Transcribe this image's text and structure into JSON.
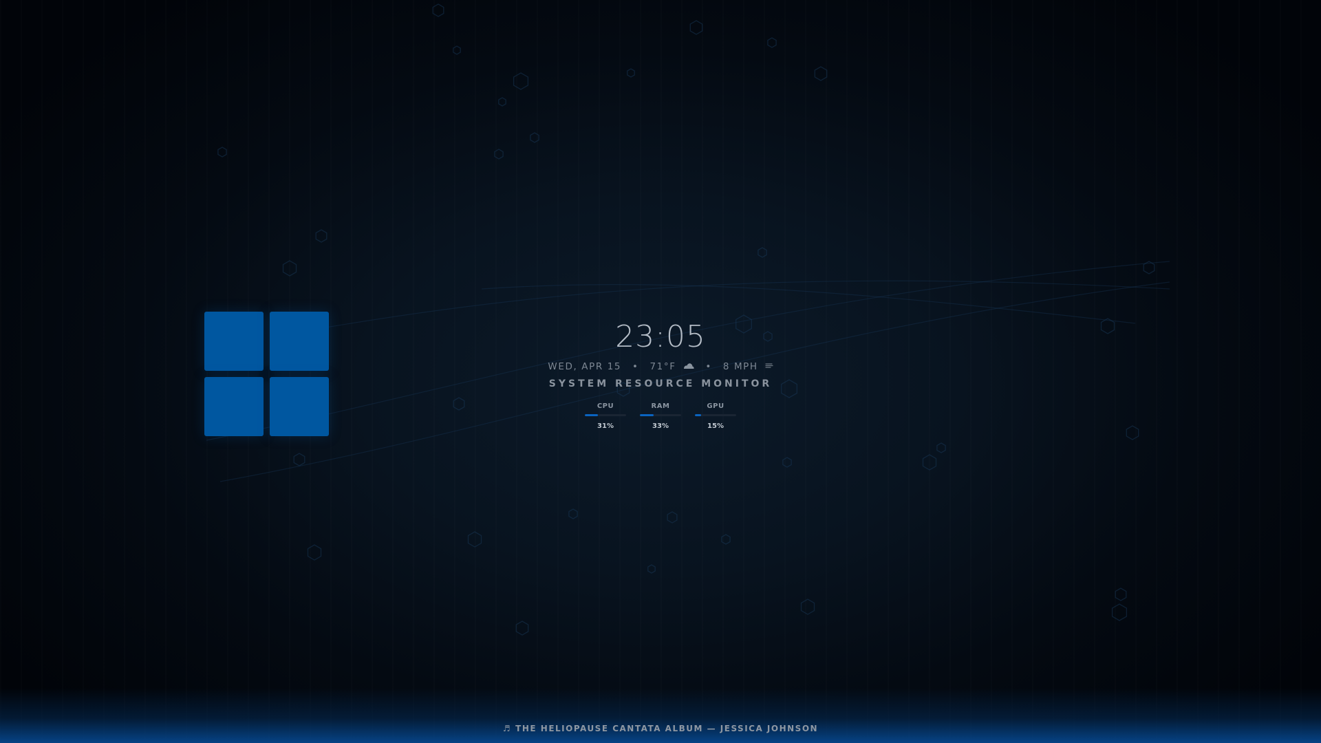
{
  "wallpaper": {
    "logo_name": "Windows",
    "logo_color": "#0057a0",
    "accent_color": "#0a64c0"
  },
  "clock": {
    "time": "23:05"
  },
  "info": {
    "date": "WED, APR 15",
    "separator": "•",
    "temperature": "71°F",
    "weather_icon": "cloud-icon",
    "wind": "8 MPH",
    "wind_icon": "wind-icon"
  },
  "monitor": {
    "title": "SYSTEM RESOURCE MONITOR",
    "stats": [
      {
        "label": "CPU",
        "value": "31%",
        "percent": 31
      },
      {
        "label": "RAM",
        "value": "33%",
        "percent": 33
      },
      {
        "label": "GPU",
        "value": "15%",
        "percent": 15
      }
    ]
  },
  "now_playing": {
    "icon": "music-note-icon",
    "icon_glyph": "♬",
    "text": "THE HELIOPAUSE CANTATA ALBUM — JESSICA JOHNSON"
  }
}
